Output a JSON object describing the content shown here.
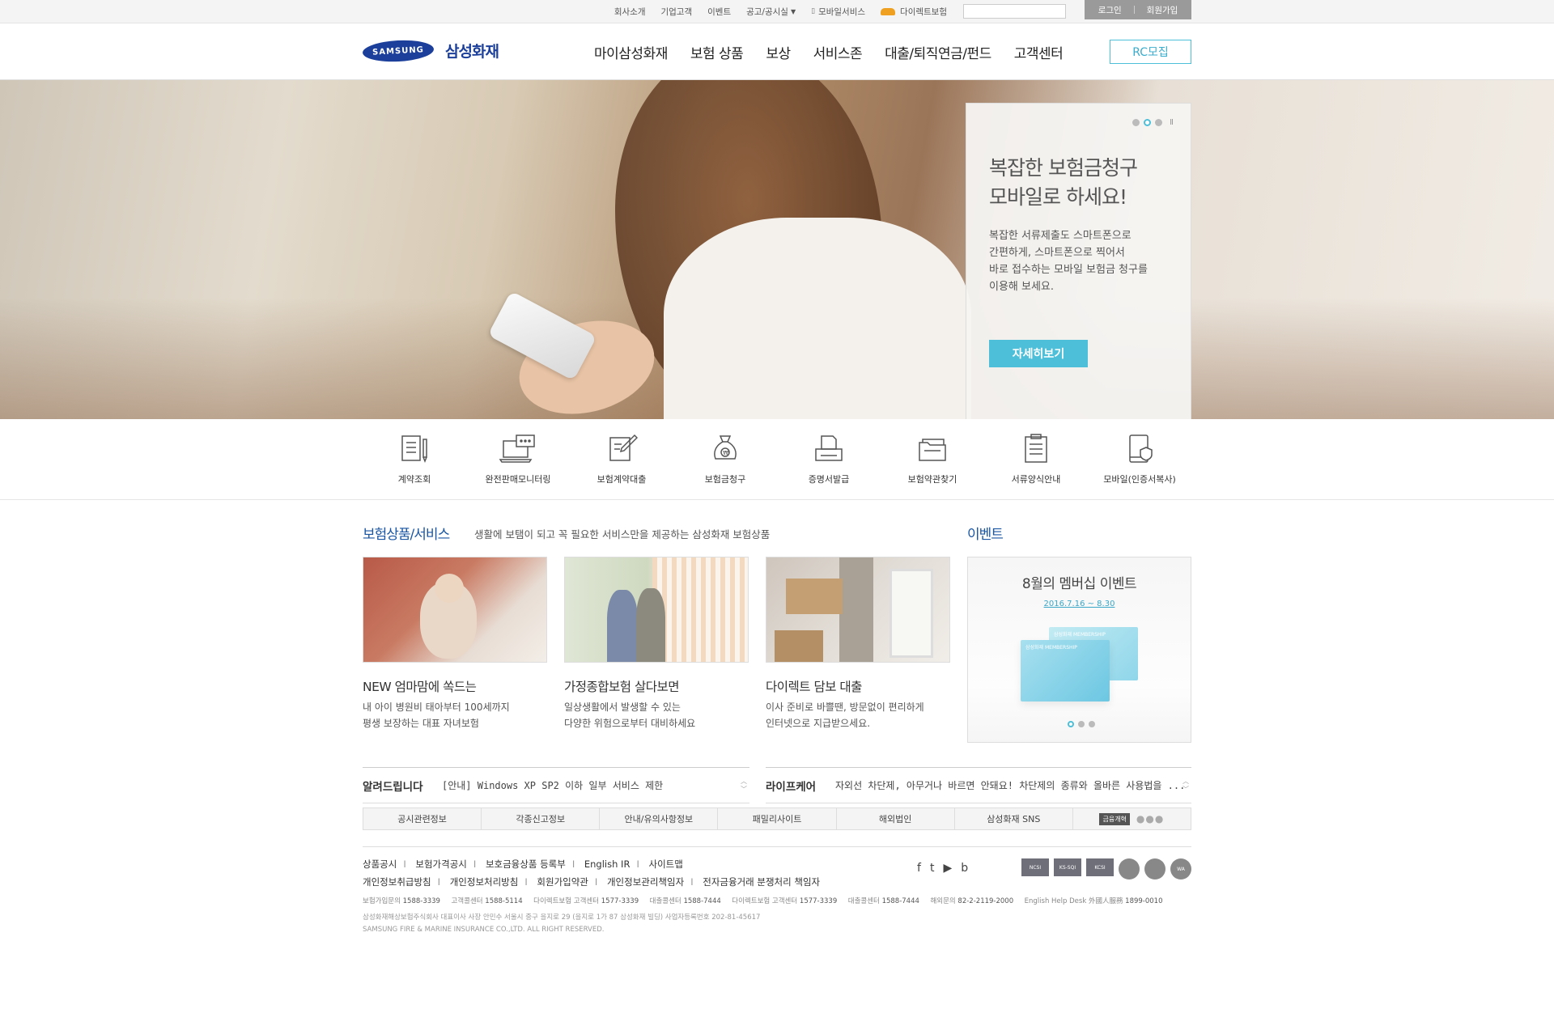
{
  "util": {
    "links": [
      "회사소개",
      "기업고객",
      "이벤트",
      "공고/공시실",
      "모바일서비스",
      "다이렉트보험"
    ],
    "login": "로그인",
    "join": "회원가입"
  },
  "header": {
    "logo_mark": "SAMSUNG",
    "logo_text": "삼성화재",
    "gnb": [
      "마이삼성화재",
      "보험 상품",
      "보상",
      "서비스존",
      "대출/퇴직연금/펀드",
      "고객센터"
    ],
    "rc_button": "RC모집"
  },
  "hero": {
    "title_line1": "복잡한 보험금청구",
    "title_line2": "모바일로 하세요!",
    "desc": [
      "복잡한 서류제출도 스마트폰으로",
      "간편하게, 스마트폰으로 찍어서",
      "바로 접수하는 모바일 보험금 청구를",
      "이용해 보세요."
    ],
    "button": "자세히보기",
    "pause": "II"
  },
  "quick": [
    "계약조회",
    "완전판매모니터링",
    "보험계약대출",
    "보험금청구",
    "증명서발급",
    "보험약관찾기",
    "서류양식안내",
    "모바일(인증서복사)"
  ],
  "products": {
    "title": "보험상품/서비스",
    "subtitle": "생활에 보탬이 되고 꼭 필요한 서비스만을 제공하는 삼성화재 보험상품",
    "cards": [
      {
        "title": "NEW 엄마맘에 쏙드는",
        "desc1": "내 아이 병원비 태아부터 100세까지",
        "desc2": "평생 보장하는 대표 자녀보험"
      },
      {
        "title": "가정종합보험 살다보면",
        "desc1": "일상생활에서 발생할 수 있는",
        "desc2": "다양한 위험으로부터 대비하세요"
      },
      {
        "title": "다이렉트 담보 대출",
        "desc1": "이사 준비로 바쁠땐, 방문없이 편리하게",
        "desc2": "인터넷으로 지급받으세요."
      }
    ]
  },
  "event": {
    "title": "이벤트",
    "name": "8월의 멤버십 이벤트",
    "date": "2016.7.16 ~ 8.30",
    "card_label": "삼성화재 MEMBERSHIP"
  },
  "notice": {
    "title": "알려드립니다",
    "text": "[안내] Windows XP SP2 이하 일부 서비스 제한"
  },
  "lifecare": {
    "title": "라이프케어",
    "text": "자외선 차단제, 아무거나 바르면 안돼요! 차단제의 종류와 올바른 사용법을 ..."
  },
  "tabs": [
    "공시관련정보",
    "각종신고정보",
    "안내/유의사항정보",
    "패밀리사이트",
    "해외법인",
    "삼성화재 SNS"
  ],
  "tab_fin": "금융개혁",
  "footer": {
    "links1": [
      "상품공시",
      "보험가격공시",
      "보호금융상품 등록부",
      "English IR",
      "사이트맵"
    ],
    "links2": [
      "개인정보취급방침",
      "개인정보처리방침",
      "회원가입약관",
      "개인정보관리책임자",
      "전자금융거래 분쟁처리 책임자"
    ],
    "sns": [
      "f",
      "t",
      "▶",
      "b"
    ],
    "badges": [
      "NCSI",
      "KS-SQI",
      "KCSI",
      "",
      "",
      "WA"
    ],
    "contacts": [
      {
        "label": "보험가입문의",
        "num": "1588-3339"
      },
      {
        "label": "고객콜센터",
        "num": "1588-5114"
      },
      {
        "label": "다이렉트보험 고객센터",
        "num": "1577-3339"
      },
      {
        "label": "대출콜센터",
        "num": "1588-7444"
      },
      {
        "label": "다이렉트보험 고객센터",
        "num": "1577-3339"
      },
      {
        "label": "대출콜센터",
        "num": "1588-7444"
      },
      {
        "label": "해외문의",
        "num": "82-2-2119-2000"
      },
      {
        "label": "English Help Desk 外國人服務",
        "num": "1899-0010"
      }
    ],
    "address": "삼성화재해상보험주식회사 대표이사 사장 안민수   서울시 중구 을지로 29 (을지로 1가 87 삼성화재 빌딩) 사업자등록번호 202-81-45617",
    "copyright": "SAMSUNG FIRE & MARINE INSURANCE CO.,LTD. ALL RIGHT RESERVED."
  }
}
